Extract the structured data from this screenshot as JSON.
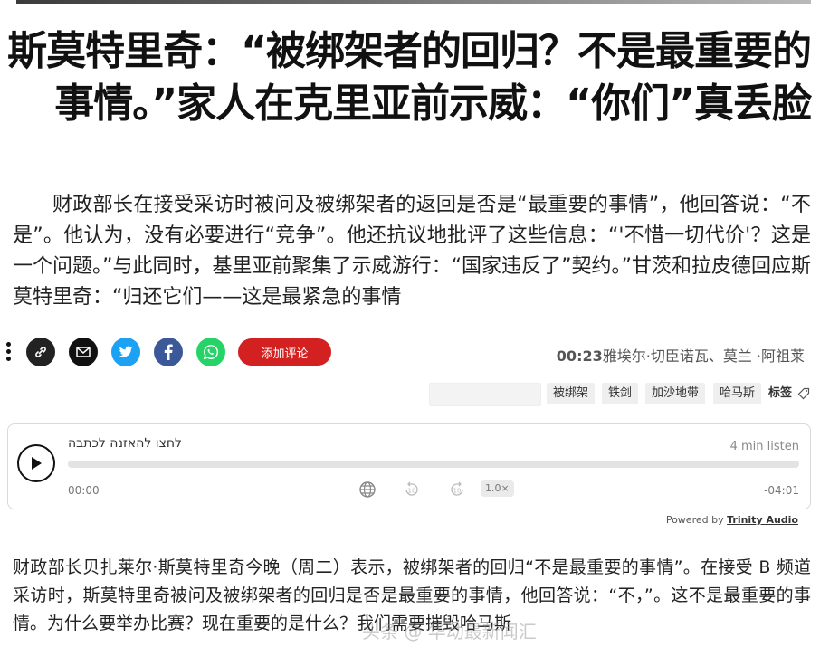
{
  "article": {
    "headline": "斯莫特里奇：“被绑架者的回归？不是最重要的事情。”家人在克里亚前示威：“你们”真丢脸",
    "lead": "财政部长在接受采访时被问及被绑架者的返回是否是“最重要的事情”，他回答说：“不是”。他认为，没有必要进行“竞争”。他还抗议地批评了这些信息：“'不惜一切代价'？这是一个问题。”与此同时，基里亚前聚集了示威游行：“国家违反了”契约。”甘茨和拉皮德回应斯莫特里奇：“归还它们——这是最紧急的事情",
    "body": "财政部长贝扎莱尔·斯莫特里奇今晚（周二）表示，被绑架者的回归“不是最重要的事情”。在接受 B 频道采访时，斯莫特里奇被问及被绑架者的回归是否是最重要的事情，他回答说：“不，”。这不是最重要的事情。为什么要举办比赛？现在重要的是什么？我们需要摧毁哈马斯"
  },
  "share_bar": {
    "icons": [
      "more-dots-icon",
      "link-icon",
      "email-icon",
      "twitter-icon",
      "facebook-icon",
      "whatsapp-icon"
    ],
    "comment_button": "添加评论",
    "byline_time": "00:23",
    "byline_authors": "雅埃尔·切臣诺瓦、莫兰 ·阿祖莱"
  },
  "tags": {
    "items": [
      "被绑架",
      "铁剑",
      "加沙地带",
      "哈马斯"
    ],
    "label": "标签"
  },
  "audio_player": {
    "title": "לחצו להאזנה לכתבה",
    "duration": "4 min listen",
    "current_time": "00:00",
    "remaining_time": "-04:01",
    "speed": "1.0×",
    "progress": 0,
    "skip_back": "10",
    "skip_forward": "10"
  },
  "powered_by": {
    "prefix": "Powered by",
    "brand": "Trinity Audio"
  },
  "watermark": "头条 @ 华动最新闻汇",
  "colors": {
    "comment_button": "#d32020",
    "twitter": "#1da1f2",
    "facebook": "#3b5998",
    "whatsapp": "#25d366"
  }
}
